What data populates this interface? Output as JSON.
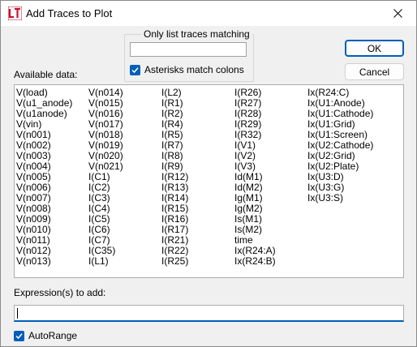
{
  "window": {
    "title": "Add Traces to Plot"
  },
  "filter": {
    "legend": "Only list traces matching",
    "value": "",
    "asterisk_checkbox_label": "Asterisks match colons",
    "asterisk_checked": true
  },
  "buttons": {
    "ok_label": "OK",
    "cancel_label": "Cancel"
  },
  "available_data_label": "Available data:",
  "available_data": {
    "columns": [
      [
        "V(load)",
        "V(u1_anode)",
        "V(u1anode)",
        "V(vin)",
        "V(n001)",
        "V(n002)",
        "V(n003)",
        "V(n004)",
        "V(n005)",
        "V(n006)",
        "V(n007)",
        "V(n008)",
        "V(n009)",
        "V(n010)",
        "V(n011)",
        "V(n012)",
        "V(n013)"
      ],
      [
        "V(n014)",
        "V(n015)",
        "V(n016)",
        "V(n017)",
        "V(n018)",
        "V(n019)",
        "V(n020)",
        "V(n021)",
        "I(C1)",
        "I(C2)",
        "I(C3)",
        "I(C4)",
        "I(C5)",
        "I(C6)",
        "I(C7)",
        "I(C35)",
        "I(L1)"
      ],
      [
        "I(L2)",
        "I(R1)",
        "I(R2)",
        "I(R4)",
        "I(R5)",
        "I(R7)",
        "I(R8)",
        "I(R9)",
        "I(R12)",
        "I(R13)",
        "I(R14)",
        "I(R15)",
        "I(R16)",
        "I(R17)",
        "I(R21)",
        "I(R22)",
        "I(R25)"
      ],
      [
        "I(R26)",
        "I(R27)",
        "I(R28)",
        "I(R29)",
        "I(R32)",
        "I(V1)",
        "I(V2)",
        "I(V3)",
        "Id(M1)",
        "Id(M2)",
        "Ig(M1)",
        "Ig(M2)",
        "Is(M1)",
        "Is(M2)",
        "time",
        "Ix(R24:A)",
        "Ix(R24:B)"
      ],
      [
        "Ix(R24:C)",
        "Ix(U1:Anode)",
        "Ix(U1:Cathode)",
        "Ix(U1:Grid)",
        "Ix(U1:Screen)",
        "Ix(U2:Cathode)",
        "Ix(U2:Grid)",
        "Ix(U2:Plate)",
        "Ix(U3:D)",
        "Ix(U3:G)",
        "Ix(U3:S)"
      ]
    ]
  },
  "expression": {
    "label": "Expression(s) to add:",
    "value": ""
  },
  "autorange": {
    "label": "AutoRange",
    "checked": true
  },
  "colors": {
    "accent": "#005fb8",
    "app_icon": "#c8102e"
  },
  "icons": {
    "app": "ltspice-app-icon",
    "close": "close-icon",
    "check": "checkmark-icon"
  }
}
